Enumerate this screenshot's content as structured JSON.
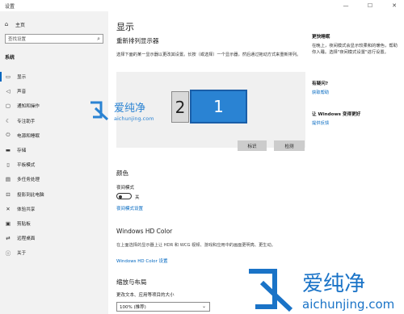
{
  "window": {
    "title": "设置",
    "minimize": "—",
    "maximize": "☐",
    "close": "✕"
  },
  "sidebar": {
    "home_label": "主页",
    "search_placeholder": "查找设置",
    "group_title": "系统",
    "items": [
      {
        "label": "显示",
        "icon": "monitor-icon",
        "glyph": "▭",
        "active": true
      },
      {
        "label": "声音",
        "icon": "speaker-icon",
        "glyph": "◁"
      },
      {
        "label": "通知和操作",
        "icon": "notification-icon",
        "glyph": "▢"
      },
      {
        "label": "专注助手",
        "icon": "moon-icon",
        "glyph": "☾"
      },
      {
        "label": "电源和睡眠",
        "icon": "power-icon",
        "glyph": "⏻"
      },
      {
        "label": "存储",
        "icon": "storage-icon",
        "glyph": "▬"
      },
      {
        "label": "平板模式",
        "icon": "tablet-icon",
        "glyph": "▯"
      },
      {
        "label": "多任务处理",
        "icon": "multitask-icon",
        "glyph": "▤"
      },
      {
        "label": "投影到此电脑",
        "icon": "project-icon",
        "glyph": "⊡"
      },
      {
        "label": "体验共享",
        "icon": "share-icon",
        "glyph": "✕"
      },
      {
        "label": "剪贴板",
        "icon": "clipboard-icon",
        "glyph": "▣"
      },
      {
        "label": "远程桌面",
        "icon": "remote-icon",
        "glyph": "⇄"
      },
      {
        "label": "关于",
        "icon": "info-icon",
        "glyph": "ⓘ"
      }
    ]
  },
  "main": {
    "page_title": "显示",
    "rearrange_title": "重新排列显示器",
    "rearrange_desc": "选择下面的某一显示器以更改其设置。长按（或选择）一个显示器，然后通过拖动方式来重新排列。",
    "monitor_2": "2",
    "monitor_1": "1",
    "identify_button": "标识",
    "detect_button": "检测",
    "color_title": "颜色",
    "night_light_label": "夜间模式",
    "night_light_state": "关",
    "night_light_settings_link": "夜间模式设置",
    "hd_title": "Windows HD Color",
    "hd_desc": "在上面选择的显示器上让 HDR 和 WCG 视频、游戏和应用中的画面更明亮、更生动。",
    "hd_settings_link": "Windows HD Color 设置",
    "scale_title": "缩放与布局",
    "scale_label": "更改文本、应用等项目的大小",
    "scale_value": "100% (推荐)"
  },
  "right_panel": {
    "sleep_title": "更快睡眠",
    "sleep_desc": "在晚上，夜间模式会显示较柔和的暖色，帮助你入睡。选择\"夜间模式设置\"进行设置。",
    "question_title": "有疑问?",
    "help_link": "获取帮助",
    "better_title": "让 Windows 变得更好",
    "feedback_link": "提供反馈"
  },
  "watermark": {
    "brand": "爱纯净",
    "url": "aichunjing.com"
  },
  "colors": {
    "accent": "#0067c0",
    "monitor_blue": "#2a83d3",
    "sidebar_bg": "#f2f2f2"
  }
}
